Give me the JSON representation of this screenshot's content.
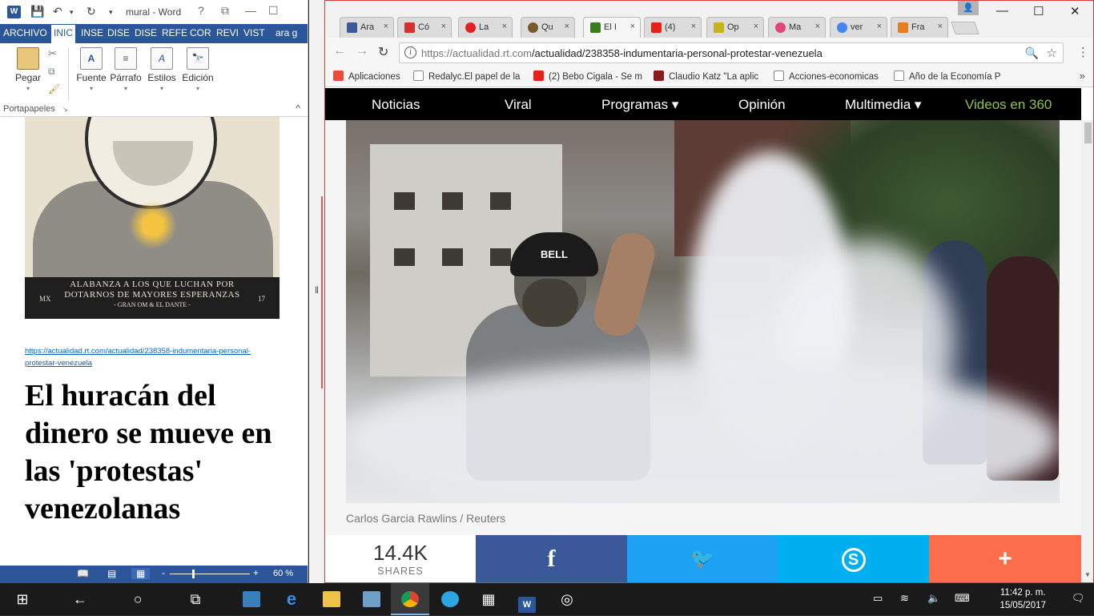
{
  "word": {
    "title": "mural - Word",
    "logo": "W",
    "qa_icons": [
      "save-icon",
      "undo-icon",
      "redo-icon"
    ],
    "title_controls": [
      "?",
      "⧉",
      "—",
      "☐"
    ],
    "tabs": [
      "ARCHIVO",
      "INIC",
      "INSE",
      "DISE",
      "DISE",
      "REFE",
      "COR",
      "REVI",
      "VIST",
      "ara g"
    ],
    "ribbon": {
      "groups": [
        {
          "label": "Pegar",
          "icon": "paste-icon"
        },
        {
          "label": "Fuente",
          "icon": "font-icon"
        },
        {
          "label": "Párrafo",
          "icon": "paragraph-icon"
        },
        {
          "label": "Estilos",
          "icon": "styles-icon"
        },
        {
          "label": "Edición",
          "icon": "find-icon"
        }
      ],
      "footer_label": "Portapapeles",
      "collapse": "^"
    },
    "document": {
      "poster_caption_1": "ALABANZA A LOS QUE LUCHAN POR",
      "poster_caption_2": "DOTARNOS DE MAYORES ESPERANZAS",
      "poster_credit": "- GRAN OM & EL DANTE -",
      "poster_left": "MX",
      "poster_right": "17",
      "link": "https://actualidad.rt.com/actualidad/238358-indumentaria-personal-protestar-venezuela",
      "headline": "El huracán del dinero se mueve en las 'protestas' venezolanas"
    },
    "status": {
      "zoom": "60 %",
      "zoom_minus": "-",
      "zoom_plus": "+"
    }
  },
  "chrome": {
    "tabs": [
      {
        "label": "Ara",
        "color": "#3b5998",
        "active": false
      },
      {
        "label": "Có",
        "color": "#d0342c",
        "active": false
      },
      {
        "label": "La",
        "color": "#e32222",
        "active": false
      },
      {
        "label": "Qu",
        "color": "#7a5a2a",
        "active": false
      },
      {
        "label": "El I",
        "color": "#3a7d1e",
        "active": true
      },
      {
        "label": "(4)",
        "color": "#e62117",
        "active": false
      },
      {
        "label": "Op",
        "color": "#c8b21e",
        "active": false
      },
      {
        "label": "Ma",
        "color": "#e0457b",
        "active": false
      },
      {
        "label": "ver",
        "color": "#4285f4",
        "active": false
      },
      {
        "label": "Fra",
        "color": "#e67e22",
        "active": false
      }
    ],
    "tab_close": "×",
    "window_controls": [
      "—",
      "☐",
      "✕"
    ],
    "profile": "👤",
    "url_host": "https://actualidad.rt.com",
    "url_path": "/actualidad/238358-indumentaria-personal-protestar-venezuela",
    "bookmarks": [
      {
        "label": "Aplicaciones",
        "color": "#e84c3d"
      },
      {
        "label": "Redalyc.El papel de la",
        "color": "#ffffff"
      },
      {
        "label": "(2) Bebo Cigala - Se m",
        "color": "#e62117"
      },
      {
        "label": "Claudio Katz \"La aplic",
        "color": "#8b1a1a"
      },
      {
        "label": "Acciones-economicas",
        "color": "#ffffff"
      },
      {
        "label": "Año de la Economía P",
        "color": "#ffffff"
      }
    ],
    "bookmarks_more": "»",
    "site_nav": [
      {
        "label": "Noticias",
        "green": false
      },
      {
        "label": "Viral",
        "green": false
      },
      {
        "label": "Programas ▾",
        "green": false
      },
      {
        "label": "Opinión",
        "green": false
      },
      {
        "label": "Multimedia ▾",
        "green": false
      },
      {
        "label": "Videos en 360",
        "green": true
      }
    ],
    "photo_helmet_text": "BELL",
    "photo_credit": "Carlos Garcia Rawlins / Reuters",
    "share": {
      "count": "14.4K",
      "count_label": "SHARES",
      "buttons": [
        {
          "name": "facebook",
          "glyph": "f",
          "color": "#3b5998"
        },
        {
          "name": "twitter",
          "glyph": "🐦",
          "color": "#1da1f2"
        },
        {
          "name": "skype",
          "glyph": "S",
          "color": "#00aff0"
        },
        {
          "name": "more",
          "glyph": "+",
          "color": "#fc6d4c"
        }
      ]
    }
  },
  "taskbar": {
    "apps": [
      "start-icon",
      "back-icon",
      "cortana-icon",
      "task-view-icon",
      "edge-icon",
      "explorer-icon",
      "devices-icon",
      "chrome-icon",
      "telegram-icon",
      "calculator-icon",
      "word-icon",
      "groove-icon"
    ],
    "time": "11:42 p. m.",
    "date": "15/05/2017"
  }
}
